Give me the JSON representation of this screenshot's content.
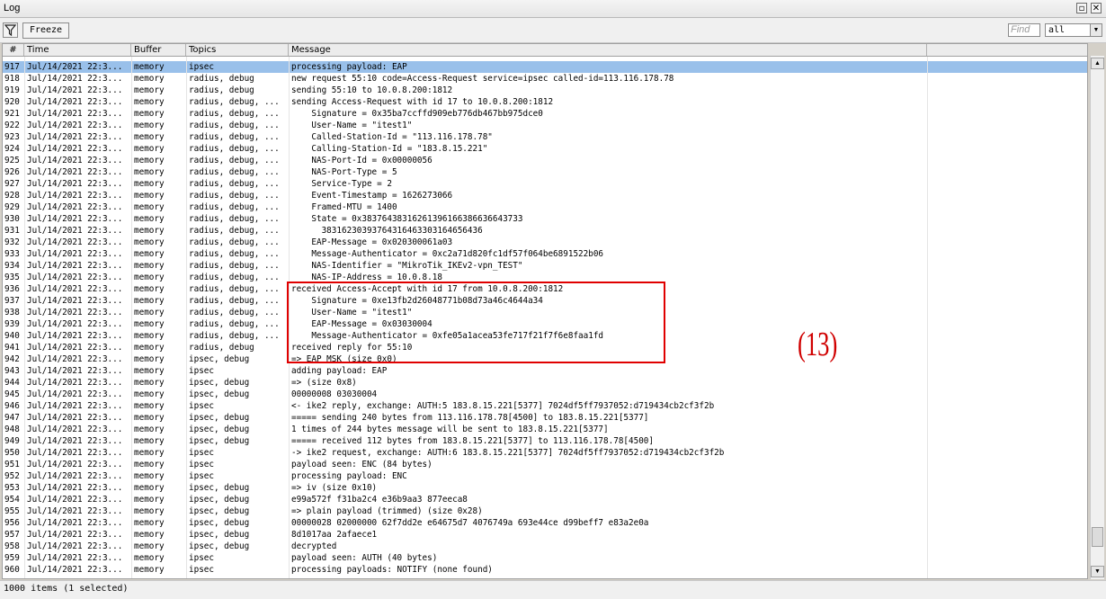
{
  "window": {
    "title": "Log",
    "restore_icon": "restore-icon",
    "close_icon": "close-icon"
  },
  "toolbar": {
    "freeze_label": "Freeze",
    "find_placeholder": "Find",
    "topic_value": "all"
  },
  "columns": {
    "num": "#",
    "time": "Time",
    "buffer": "Buffer",
    "topics": "Topics",
    "message": "Message"
  },
  "annotation": {
    "label": "(13)",
    "box_color": "#e00000"
  },
  "status": {
    "text": "1000 items (1 selected)"
  },
  "colors": {
    "selection": "#99c0ea",
    "accent": "#e00000"
  },
  "rows": [
    {
      "n": "917",
      "t": "Jul/14/2021 22:3...",
      "b": "memory",
      "tp": "ipsec",
      "m": "processing payload: EAP",
      "sel": true
    },
    {
      "n": "918",
      "t": "Jul/14/2021 22:3...",
      "b": "memory",
      "tp": "radius, debug",
      "m": "new request 55:10 code=Access-Request service=ipsec called-id=113.116.178.78"
    },
    {
      "n": "919",
      "t": "Jul/14/2021 22:3...",
      "b": "memory",
      "tp": "radius, debug",
      "m": "sending 55:10 to 10.0.8.200:1812"
    },
    {
      "n": "920",
      "t": "Jul/14/2021 22:3...",
      "b": "memory",
      "tp": "radius, debug, ...",
      "m": "sending Access-Request with id 17 to 10.0.8.200:1812"
    },
    {
      "n": "921",
      "t": "Jul/14/2021 22:3...",
      "b": "memory",
      "tp": "radius, debug, ...",
      "m": "    Signature = 0x35ba7ccffd909eb776db467bb975dce0"
    },
    {
      "n": "922",
      "t": "Jul/14/2021 22:3...",
      "b": "memory",
      "tp": "radius, debug, ...",
      "m": "    User-Name = \"itest1\""
    },
    {
      "n": "923",
      "t": "Jul/14/2021 22:3...",
      "b": "memory",
      "tp": "radius, debug, ...",
      "m": "    Called-Station-Id = \"113.116.178.78\""
    },
    {
      "n": "924",
      "t": "Jul/14/2021 22:3...",
      "b": "memory",
      "tp": "radius, debug, ...",
      "m": "    Calling-Station-Id = \"183.8.15.221\""
    },
    {
      "n": "925",
      "t": "Jul/14/2021 22:3...",
      "b": "memory",
      "tp": "radius, debug, ...",
      "m": "    NAS-Port-Id = 0x00000056"
    },
    {
      "n": "926",
      "t": "Jul/14/2021 22:3...",
      "b": "memory",
      "tp": "radius, debug, ...",
      "m": "    NAS-Port-Type = 5"
    },
    {
      "n": "927",
      "t": "Jul/14/2021 22:3...",
      "b": "memory",
      "tp": "radius, debug, ...",
      "m": "    Service-Type = 2"
    },
    {
      "n": "928",
      "t": "Jul/14/2021 22:3...",
      "b": "memory",
      "tp": "radius, debug, ...",
      "m": "    Event-Timestamp = 1626273066"
    },
    {
      "n": "929",
      "t": "Jul/14/2021 22:3...",
      "b": "memory",
      "tp": "radius, debug, ...",
      "m": "    Framed-MTU = 1400"
    },
    {
      "n": "930",
      "t": "Jul/14/2021 22:3...",
      "b": "memory",
      "tp": "radius, debug, ...",
      "m": "    State = 0x38376438316261396166386636643733"
    },
    {
      "n": "931",
      "t": "Jul/14/2021 22:3...",
      "b": "memory",
      "tp": "radius, debug, ...",
      "m": "      38316230393764316463303164656436"
    },
    {
      "n": "932",
      "t": "Jul/14/2021 22:3...",
      "b": "memory",
      "tp": "radius, debug, ...",
      "m": "    EAP-Message = 0x020300061a03"
    },
    {
      "n": "933",
      "t": "Jul/14/2021 22:3...",
      "b": "memory",
      "tp": "radius, debug, ...",
      "m": "    Message-Authenticator = 0xc2a71d820fc1df57f064be6891522b06"
    },
    {
      "n": "934",
      "t": "Jul/14/2021 22:3...",
      "b": "memory",
      "tp": "radius, debug, ...",
      "m": "    NAS-Identifier = \"MikroTik_IKEv2-vpn_TEST\""
    },
    {
      "n": "935",
      "t": "Jul/14/2021 22:3...",
      "b": "memory",
      "tp": "radius, debug, ...",
      "m": "    NAS-IP-Address = 10.0.8.18"
    },
    {
      "n": "936",
      "t": "Jul/14/2021 22:3...",
      "b": "memory",
      "tp": "radius, debug, ...",
      "m": "received Access-Accept with id 17 from 10.0.8.200:1812"
    },
    {
      "n": "937",
      "t": "Jul/14/2021 22:3...",
      "b": "memory",
      "tp": "radius, debug, ...",
      "m": "    Signature = 0xe13fb2d26048771b08d73a46c4644a34"
    },
    {
      "n": "938",
      "t": "Jul/14/2021 22:3...",
      "b": "memory",
      "tp": "radius, debug, ...",
      "m": "    User-Name = \"itest1\""
    },
    {
      "n": "939",
      "t": "Jul/14/2021 22:3...",
      "b": "memory",
      "tp": "radius, debug, ...",
      "m": "    EAP-Message = 0x03030004"
    },
    {
      "n": "940",
      "t": "Jul/14/2021 22:3...",
      "b": "memory",
      "tp": "radius, debug, ...",
      "m": "    Message-Authenticator = 0xfe05a1acea53fe717f21f7f6e8faa1fd"
    },
    {
      "n": "941",
      "t": "Jul/14/2021 22:3...",
      "b": "memory",
      "tp": "radius, debug",
      "m": "received reply for 55:10"
    },
    {
      "n": "942",
      "t": "Jul/14/2021 22:3...",
      "b": "memory",
      "tp": "ipsec, debug",
      "m": "=> EAP MSK (size 0x0)"
    },
    {
      "n": "943",
      "t": "Jul/14/2021 22:3...",
      "b": "memory",
      "tp": "ipsec",
      "m": "adding payload: EAP"
    },
    {
      "n": "944",
      "t": "Jul/14/2021 22:3...",
      "b": "memory",
      "tp": "ipsec, debug",
      "m": "=> (size 0x8)"
    },
    {
      "n": "945",
      "t": "Jul/14/2021 22:3...",
      "b": "memory",
      "tp": "ipsec, debug",
      "m": "00000008 03030004"
    },
    {
      "n": "946",
      "t": "Jul/14/2021 22:3...",
      "b": "memory",
      "tp": "ipsec",
      "m": "<- ike2 reply, exchange: AUTH:5 183.8.15.221[5377] 7024df5ff7937052:d719434cb2cf3f2b"
    },
    {
      "n": "947",
      "t": "Jul/14/2021 22:3...",
      "b": "memory",
      "tp": "ipsec, debug",
      "m": "===== sending 240 bytes from 113.116.178.78[4500] to 183.8.15.221[5377]"
    },
    {
      "n": "948",
      "t": "Jul/14/2021 22:3...",
      "b": "memory",
      "tp": "ipsec, debug",
      "m": "1 times of 244 bytes message will be sent to 183.8.15.221[5377]"
    },
    {
      "n": "949",
      "t": "Jul/14/2021 22:3...",
      "b": "memory",
      "tp": "ipsec, debug",
      "m": "===== received 112 bytes from 183.8.15.221[5377] to 113.116.178.78[4500]"
    },
    {
      "n": "950",
      "t": "Jul/14/2021 22:3...",
      "b": "memory",
      "tp": "ipsec",
      "m": "-> ike2 request, exchange: AUTH:6 183.8.15.221[5377] 7024df5ff7937052:d719434cb2cf3f2b"
    },
    {
      "n": "951",
      "t": "Jul/14/2021 22:3...",
      "b": "memory",
      "tp": "ipsec",
      "m": "payload seen: ENC (84 bytes)"
    },
    {
      "n": "952",
      "t": "Jul/14/2021 22:3...",
      "b": "memory",
      "tp": "ipsec",
      "m": "processing payload: ENC"
    },
    {
      "n": "953",
      "t": "Jul/14/2021 22:3...",
      "b": "memory",
      "tp": "ipsec, debug",
      "m": "=> iv (size 0x10)"
    },
    {
      "n": "954",
      "t": "Jul/14/2021 22:3...",
      "b": "memory",
      "tp": "ipsec, debug",
      "m": "e99a572f f31ba2c4 e36b9aa3 877eeca8"
    },
    {
      "n": "955",
      "t": "Jul/14/2021 22:3...",
      "b": "memory",
      "tp": "ipsec, debug",
      "m": "=> plain payload (trimmed) (size 0x28)"
    },
    {
      "n": "956",
      "t": "Jul/14/2021 22:3...",
      "b": "memory",
      "tp": "ipsec, debug",
      "m": "00000028 02000000 62f7dd2e e64675d7 4076749a 693e44ce d99beff7 e83a2e0a"
    },
    {
      "n": "957",
      "t": "Jul/14/2021 22:3...",
      "b": "memory",
      "tp": "ipsec, debug",
      "m": "8d1017aa 2afaece1"
    },
    {
      "n": "958",
      "t": "Jul/14/2021 22:3...",
      "b": "memory",
      "tp": "ipsec, debug",
      "m": "decrypted"
    },
    {
      "n": "959",
      "t": "Jul/14/2021 22:3...",
      "b": "memory",
      "tp": "ipsec",
      "m": "payload seen: AUTH (40 bytes)"
    },
    {
      "n": "960",
      "t": "Jul/14/2021 22:3...",
      "b": "memory",
      "tp": "ipsec",
      "m": "processing payloads: NOTIFY (none found)"
    }
  ]
}
